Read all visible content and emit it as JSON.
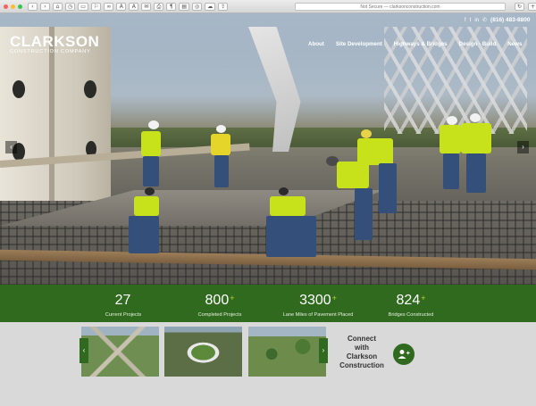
{
  "browser": {
    "url_text": "Not Secure — clarksonconstruction.com",
    "toolbar_icons": [
      "back-icon",
      "forward-icon",
      "home-icon",
      "history-icon",
      "zoom-out-icon",
      "zoom-in-icon",
      "print-icon",
      "reader-icon",
      "share-icon",
      "extensions-icon"
    ],
    "zoom_small": "A",
    "zoom_large": "A"
  },
  "logo": {
    "main": "CLARKSON",
    "sub": "CONSTRUCTION COMPANY"
  },
  "social": {
    "facebook": "f",
    "twitter": "t",
    "linkedin": "in",
    "phone": "(816) 483-8800"
  },
  "nav": {
    "items": [
      "About",
      "Site Development",
      "Highways & Bridges",
      "Design - Build",
      "News"
    ]
  },
  "hero": {
    "prev": "‹",
    "next": "›"
  },
  "stats": [
    {
      "value": "27",
      "plus": "",
      "label": "Current Projects"
    },
    {
      "value": "800",
      "plus": "+",
      "label": "Completed Projects"
    },
    {
      "value": "3300",
      "plus": "+",
      "label": "Lane Miles of Pavement Placed"
    },
    {
      "value": "824",
      "plus": "+",
      "label": "Bridges Constructed"
    }
  ],
  "gallery": {
    "prev": "‹",
    "next": "›"
  },
  "connect": {
    "line1": "Connect",
    "line2": "with",
    "line3": "Clarkson",
    "line4": "Construction",
    "icon": "add-user-icon"
  },
  "colors": {
    "brand_green": "#2f6a1f",
    "accent_lime": "#b9d631"
  }
}
